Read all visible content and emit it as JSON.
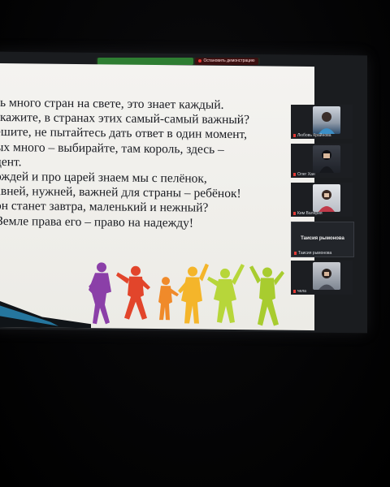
{
  "share_bar": {
    "status_text": "",
    "stop_label": "Остановить демонстрацию"
  },
  "slide": {
    "lines": [
      "ь много стран на свете, это знает каждый.",
      "кажите, в странах этих самый-самый важный?",
      "ешите, не пытайтесь дать ответ в один момент,",
      "ых много – выбирайте, там король, здесь –",
      "дент.",
      "ождей и про царей знаем мы с пелёнок,",
      "авней, нужней, важней для страны – ребёнок!",
      "он станет завтра, маленький и нежный?",
      "Земле права его – право на надежду!"
    ],
    "silhouette_colors": [
      "#8b3fa8",
      "#e2452b",
      "#f08a2a",
      "#f4b52a",
      "#b7d63a",
      "#a8cc2f"
    ]
  },
  "participants": [
    {
      "name": "Любовь Крайнова"
    },
    {
      "name": "Олег Хан"
    },
    {
      "name": "Ким Валерия"
    },
    {
      "name": "Таисия рымонова",
      "caption": "Таисия рымонова"
    },
    {
      "name": "чела"
    }
  ]
}
